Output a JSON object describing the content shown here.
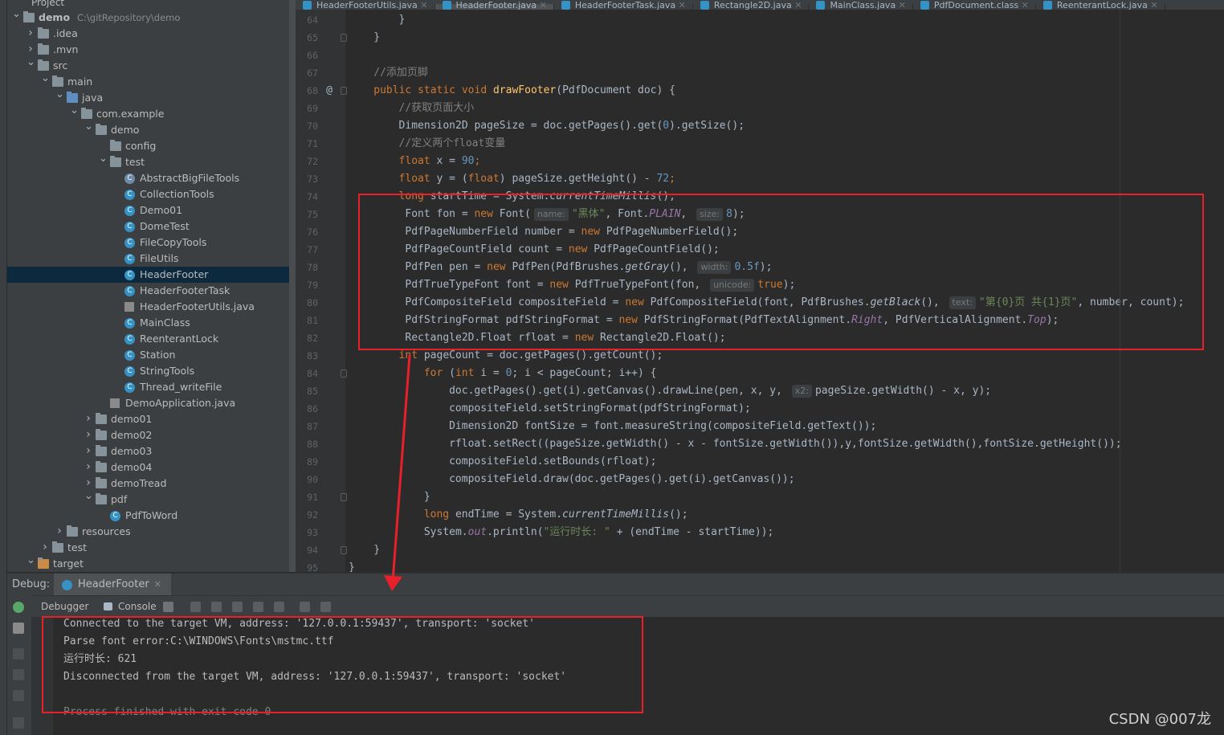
{
  "project": {
    "header": "Project",
    "tree": [
      {
        "label": "demo",
        "path": "C:\\gitRepository\\demo",
        "depth": 0,
        "arrow": "v",
        "icon": "folder",
        "bold": true
      },
      {
        "label": ".idea",
        "depth": 1,
        "arrow": ">",
        "icon": "folder"
      },
      {
        "label": ".mvn",
        "depth": 1,
        "arrow": ">",
        "icon": "folder"
      },
      {
        "label": "src",
        "depth": 1,
        "arrow": "v",
        "icon": "folder"
      },
      {
        "label": "main",
        "depth": 2,
        "arrow": "v",
        "icon": "folder"
      },
      {
        "label": "java",
        "depth": 3,
        "arrow": "v",
        "icon": "folder-blue"
      },
      {
        "label": "com.example",
        "depth": 4,
        "arrow": "v",
        "icon": "package"
      },
      {
        "label": "demo",
        "depth": 5,
        "arrow": "v",
        "icon": "package"
      },
      {
        "label": "config",
        "depth": 6,
        "arrow": "",
        "icon": "package"
      },
      {
        "label": "test",
        "depth": 6,
        "arrow": "v",
        "icon": "package"
      },
      {
        "label": "AbstractBigFileTools",
        "depth": 7,
        "arrow": "",
        "icon": "abstract-class"
      },
      {
        "label": "CollectionTools",
        "depth": 7,
        "arrow": "",
        "icon": "class"
      },
      {
        "label": "Demo01",
        "depth": 7,
        "arrow": "",
        "icon": "class"
      },
      {
        "label": "DomeTest",
        "depth": 7,
        "arrow": "",
        "icon": "class"
      },
      {
        "label": "FileCopyTools",
        "depth": 7,
        "arrow": "",
        "icon": "class"
      },
      {
        "label": "FileUtils",
        "depth": 7,
        "arrow": "",
        "icon": "class"
      },
      {
        "label": "HeaderFooter",
        "depth": 7,
        "arrow": "",
        "icon": "class",
        "selected": true
      },
      {
        "label": "HeaderFooterTask",
        "depth": 7,
        "arrow": "",
        "icon": "class"
      },
      {
        "label": "HeaderFooterUtils.java",
        "depth": 7,
        "arrow": "",
        "icon": "java-file"
      },
      {
        "label": "MainClass",
        "depth": 7,
        "arrow": "",
        "icon": "class"
      },
      {
        "label": "ReenterantLock",
        "depth": 7,
        "arrow": "",
        "icon": "class"
      },
      {
        "label": "Station",
        "depth": 7,
        "arrow": "",
        "icon": "class"
      },
      {
        "label": "StringTools",
        "depth": 7,
        "arrow": "",
        "icon": "class"
      },
      {
        "label": "Thread_writeFile",
        "depth": 7,
        "arrow": "",
        "icon": "class"
      },
      {
        "label": "DemoApplication.java",
        "depth": 6,
        "arrow": "",
        "icon": "java-file"
      },
      {
        "label": "demo01",
        "depth": 5,
        "arrow": ">",
        "icon": "package"
      },
      {
        "label": "demo02",
        "depth": 5,
        "arrow": ">",
        "icon": "package"
      },
      {
        "label": "demo03",
        "depth": 5,
        "arrow": ">",
        "icon": "package"
      },
      {
        "label": "demo04",
        "depth": 5,
        "arrow": ">",
        "icon": "package"
      },
      {
        "label": "demoTread",
        "depth": 5,
        "arrow": ">",
        "icon": "package"
      },
      {
        "label": "pdf",
        "depth": 5,
        "arrow": "v",
        "icon": "package"
      },
      {
        "label": "PdfToWord",
        "depth": 6,
        "arrow": "",
        "icon": "class"
      },
      {
        "label": "resources",
        "depth": 3,
        "arrow": ">",
        "icon": "folder"
      },
      {
        "label": "test",
        "depth": 2,
        "arrow": ">",
        "icon": "folder"
      },
      {
        "label": "target",
        "depth": 1,
        "arrow": "v",
        "icon": "folder-orange"
      }
    ]
  },
  "tabs": [
    {
      "label": "HeaderFooterUtils.java",
      "active": false
    },
    {
      "label": "HeaderFooter.java",
      "active": true
    },
    {
      "label": "HeaderFooterTask.java",
      "active": false
    },
    {
      "label": "Rectangle2D.java",
      "active": false
    },
    {
      "label": "MainClass.java",
      "active": false
    },
    {
      "label": "PdfDocument.class",
      "active": false
    },
    {
      "label": "ReenterantLock.java",
      "active": false
    }
  ],
  "editor": {
    "first_line": 64,
    "lines": [
      {
        "n": "64",
        "ind": 8,
        "t": [
          [
            "}",
            ""
          ]
        ]
      },
      {
        "n": "65",
        "ind": 4,
        "t": [
          [
            "}",
            ""
          ]
        ]
      },
      {
        "n": "66",
        "ind": 0,
        "t": []
      },
      {
        "n": "67",
        "ind": 4,
        "t": [
          [
            "//添加页脚",
            "cm"
          ]
        ]
      },
      {
        "n": "68",
        "ind": 4,
        "gutter": "@",
        "t": [
          [
            "public static void ",
            "kw"
          ],
          [
            "drawFooter",
            "fn"
          ],
          [
            "(PdfDocument doc) {",
            ""
          ]
        ]
      },
      {
        "n": "69",
        "ind": 8,
        "t": [
          [
            "//获取页面大小",
            "cm"
          ]
        ]
      },
      {
        "n": "70",
        "ind": 8,
        "t": [
          [
            "Dimension2D pageSize = doc.getPages().get(",
            ""
          ],
          [
            "0",
            "nm"
          ],
          [
            ").getSize();",
            ""
          ]
        ]
      },
      {
        "n": "71",
        "ind": 8,
        "t": [
          [
            "//定义两个float变量",
            "cm"
          ]
        ]
      },
      {
        "n": "72",
        "ind": 8,
        "t": [
          [
            "float ",
            "kw"
          ],
          [
            "x = ",
            ""
          ],
          [
            "90",
            "nm"
          ],
          [
            ";",
            "kw"
          ]
        ]
      },
      {
        "n": "73",
        "ind": 8,
        "t": [
          [
            "float ",
            "kw"
          ],
          [
            "y = (",
            ""
          ],
          [
            "float",
            "kw"
          ],
          [
            ") pageSize.getHeight() - ",
            ""
          ],
          [
            "72",
            "nm"
          ],
          [
            ";",
            "kw"
          ]
        ]
      },
      {
        "n": "74",
        "ind": 8,
        "t": [
          [
            "long ",
            "kw"
          ],
          [
            "startTime = System.",
            ""
          ],
          [
            "currentTimeMillis",
            "it"
          ],
          [
            "();",
            ""
          ]
        ]
      },
      {
        "n": "75",
        "ind": 8,
        "x": 1,
        "t": [
          [
            "Font fon = ",
            ""
          ],
          [
            "new ",
            "kw"
          ],
          [
            "Font(",
            ""
          ],
          [
            "name:",
            "hint"
          ],
          [
            "\"黑体\"",
            "st"
          ],
          [
            ", Font.",
            ""
          ],
          [
            "PLAIN",
            "pur it"
          ],
          [
            ", ",
            ""
          ],
          [
            "size:",
            "hint"
          ],
          [
            "8",
            "nm"
          ],
          [
            ");",
            ""
          ]
        ]
      },
      {
        "n": "76",
        "ind": 8,
        "x": 1,
        "t": [
          [
            "PdfPageNumberField number = ",
            ""
          ],
          [
            "new ",
            "kw"
          ],
          [
            "PdfPageNumberField();",
            ""
          ]
        ]
      },
      {
        "n": "77",
        "ind": 8,
        "x": 1,
        "t": [
          [
            "PdfPageCountField count = ",
            ""
          ],
          [
            "new ",
            "kw"
          ],
          [
            "PdfPageCountField();",
            ""
          ]
        ]
      },
      {
        "n": "78",
        "ind": 8,
        "x": 1,
        "t": [
          [
            "PdfPen pen = ",
            ""
          ],
          [
            "new ",
            "kw"
          ],
          [
            "PdfPen(PdfBrushes.",
            ""
          ],
          [
            "getGray",
            "it"
          ],
          [
            "(), ",
            ""
          ],
          [
            "width:",
            "hint"
          ],
          [
            "0.5f",
            "nm"
          ],
          [
            ");",
            ""
          ]
        ]
      },
      {
        "n": "79",
        "ind": 8,
        "x": 1,
        "t": [
          [
            "PdfTrueTypeFont font = ",
            ""
          ],
          [
            "new ",
            "kw"
          ],
          [
            "PdfTrueTypeFont(fon, ",
            ""
          ],
          [
            "unicode:",
            "hint"
          ],
          [
            "true",
            "kw"
          ],
          [
            ");",
            ""
          ]
        ]
      },
      {
        "n": "80",
        "ind": 8,
        "x": 1,
        "t": [
          [
            "PdfCompositeField compositeField = ",
            ""
          ],
          [
            "new ",
            "kw"
          ],
          [
            "PdfCompositeField(font, PdfBrushes.",
            ""
          ],
          [
            "getBlack",
            "it"
          ],
          [
            "(), ",
            ""
          ],
          [
            "text:",
            "hint"
          ],
          [
            "\"第{0}页 共{1}页\"",
            "st"
          ],
          [
            ", number, count);",
            ""
          ]
        ]
      },
      {
        "n": "81",
        "ind": 8,
        "x": 1,
        "t": [
          [
            "PdfStringFormat pdfStringFormat = ",
            ""
          ],
          [
            "new ",
            "kw"
          ],
          [
            "PdfStringFormat(PdfTextAlignment.",
            ""
          ],
          [
            "Right",
            "pur it"
          ],
          [
            ", PdfVerticalAlignment.",
            ""
          ],
          [
            "Top",
            "pur it"
          ],
          [
            ");",
            ""
          ]
        ]
      },
      {
        "n": "82",
        "ind": 8,
        "x": 1,
        "t": [
          [
            "Rectangle2D.Float rfloat = ",
            ""
          ],
          [
            "new ",
            "kw"
          ],
          [
            "Rectangle2D.Float();",
            ""
          ]
        ]
      },
      {
        "n": "83",
        "ind": 8,
        "t": [
          [
            "int ",
            "kw"
          ],
          [
            "pageCount = doc.getPages().getCount();",
            ""
          ]
        ]
      },
      {
        "n": "84",
        "ind": 12,
        "t": [
          [
            "for ",
            "kw"
          ],
          [
            "(",
            ""
          ],
          [
            "int ",
            "kw"
          ],
          [
            "i = ",
            ""
          ],
          [
            "0",
            "nm"
          ],
          [
            "; i < pageCount; i++) {",
            ""
          ]
        ]
      },
      {
        "n": "85",
        "ind": 16,
        "t": [
          [
            "doc.getPages().get(i).getCanvas().drawLine(pen, x, y, ",
            ""
          ],
          [
            "x2:",
            "hint"
          ],
          [
            "pageSize.getWidth() - x, y);",
            ""
          ]
        ]
      },
      {
        "n": "86",
        "ind": 16,
        "t": [
          [
            "compositeField.setStringFormat(pdfStringFormat);",
            ""
          ]
        ]
      },
      {
        "n": "87",
        "ind": 16,
        "t": [
          [
            "Dimension2D fontSize = font.measureString(compositeField.getText());",
            ""
          ]
        ]
      },
      {
        "n": "88",
        "ind": 16,
        "t": [
          [
            "rfloat.setRect((pageSize.getWidth() - x - fontSize.getWidth()),y,fontSize.getWidth(),fontSize.getHeight());",
            ""
          ]
        ]
      },
      {
        "n": "89",
        "ind": 16,
        "t": [
          [
            "compositeField.setBounds(rfloat);",
            ""
          ]
        ]
      },
      {
        "n": "90",
        "ind": 16,
        "t": [
          [
            "compositeField.draw(doc.getPages().get(i).getCanvas());",
            ""
          ]
        ]
      },
      {
        "n": "91",
        "ind": 12,
        "t": [
          [
            "}",
            ""
          ]
        ]
      },
      {
        "n": "92",
        "ind": 12,
        "t": [
          [
            "long ",
            "kw"
          ],
          [
            "endTime = System.",
            ""
          ],
          [
            "currentTimeMillis",
            "it"
          ],
          [
            "();",
            ""
          ]
        ]
      },
      {
        "n": "93",
        "ind": 12,
        "t": [
          [
            "System.",
            ""
          ],
          [
            "out",
            "pur it"
          ],
          [
            ".println(",
            ""
          ],
          [
            "\"运行时长: \"",
            "st"
          ],
          [
            " + (endTime - startTime));",
            ""
          ]
        ]
      },
      {
        "n": "94",
        "ind": 4,
        "t": [
          [
            "}",
            ""
          ]
        ]
      },
      {
        "n": "95",
        "ind": 0,
        "t": [
          [
            "}",
            ""
          ]
        ]
      }
    ]
  },
  "debug": {
    "label": "Debug:",
    "tab": "HeaderFooter",
    "debugger_tab": "Debugger",
    "console_tab": "Console",
    "console_lines": [
      "Connected to the target VM, address: '127.0.0.1:59437', transport: 'socket'",
      "Parse font error:C:\\WINDOWS\\Fonts\\mstmc.ttf",
      "运行时长: 621",
      "Disconnected from the target VM, address: '127.0.0.1:59437', transport: 'socket'",
      "",
      "Process finished with exit code 0"
    ]
  },
  "watermark": "CSDN @007龙",
  "colors": {
    "annotation_red": "#e8202a",
    "selection": "#0d293e",
    "accent": "#4a88c7"
  }
}
